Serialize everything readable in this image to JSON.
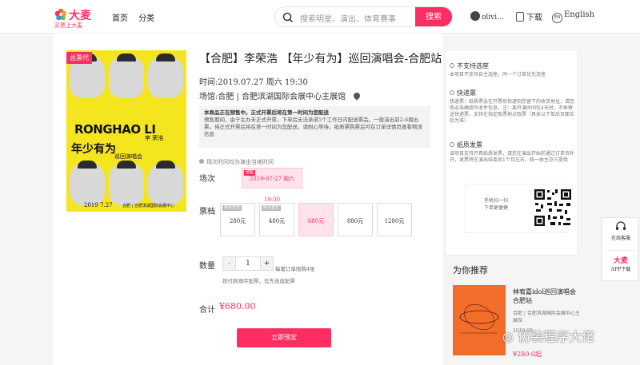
{
  "header": {
    "brand": "大麦",
    "slogan": "买票上大麦",
    "nav": [
      "首页",
      "分类"
    ],
    "search_placeholder": "搜索明星、演出、体育赛事",
    "search_button": "搜索",
    "user": "olivi…",
    "download": "下载",
    "lang_code": "EN",
    "lang": "English",
    "accent": "#ff2e62"
  },
  "poster": {
    "tag": "总票代",
    "name_en": "RONGHAO LI",
    "title_cn": "年少有为",
    "sub_cn": "李 荣浩",
    "tour": "巡回演唱会",
    "date": "2019 7.27",
    "venue": "合肥 | 合肥滨湖国际会展中心"
  },
  "event": {
    "title": "【合肥】李荣浩 【年少有为】巡回演唱会-合肥站",
    "time_label": "时间:",
    "time_value": "2019.07.27 周六 19:30",
    "venue_label": "场馆:",
    "venue_value": "合肥 | 合肥滨湖国际会展中心主展馆",
    "notice_bold": "本商品正在预售中。正式开票后将在第一时间为您配送",
    "notice_text": "预售期间，由于主办未正式开票，下单后无法承诺5个工作日内配送票品，一般演出前2-6周出票。待正式开票后将在第一时间为您配送，请耐心等待。纸质票购票后可在订单详情页查看物流信息",
    "tz_note": "场次时间均为演出当地时间",
    "session_label": "场次",
    "session_tag": "预售",
    "session_value": "2019-07-27 周六 19:30",
    "price_label": "票档",
    "prices": [
      {
        "tag": "缺货登记",
        "value": "280元",
        "selected": false
      },
      {
        "tag": "缺货登记",
        "value": "480元",
        "selected": false
      },
      {
        "tag": "",
        "value": "680元",
        "selected": true
      },
      {
        "tag": "",
        "value": "880元",
        "selected": false
      },
      {
        "tag": "",
        "value": "1280元",
        "selected": false
      }
    ],
    "qty_label": "数量",
    "qty_minus": "-",
    "qty_value": "1",
    "qty_plus": "+",
    "qty_limit": "每笔订单限购4张",
    "qty_rule": "按付款顺序配票，优先连座配票",
    "total_label": "合计",
    "total_value": "¥680.00",
    "buy_button": "立即预定"
  },
  "side": {
    "s1_title": "不支持选座",
    "s1_text": "本项目不支持自主选座，同一个订单优先连座",
    "s2_title": "快递票",
    "s2_text": "快递票：纸质票会在开票后快递到您留下的收货地址，请您务必准确填写收件信息，注：离开演时间仅4天时，不再寄送快递票，支持在指定取票地点取票（具体以下单后页面实际为准）",
    "s3_title": "纸质发票",
    "s3_text": "该项目支持开具纸质发票，请您在演出开始前通过订单页补开，发票将在演出结束后1个月左右，统一由主办方提供",
    "qr_text": "手机扫一扫\n下单更便捷"
  },
  "recommend": {
    "heading": "为你推荐",
    "title": "林宥嘉idol巡回演唱会合肥站",
    "venue": "合肥 | 合肥滨湖国际会展中心主展馆",
    "date": "2019.09…",
    "price": "¥280.0起",
    "watermark": "仿装程序大佬"
  },
  "float_bar": {
    "service": "在线客服",
    "app_brand": "大麦",
    "app": "APP下载"
  }
}
